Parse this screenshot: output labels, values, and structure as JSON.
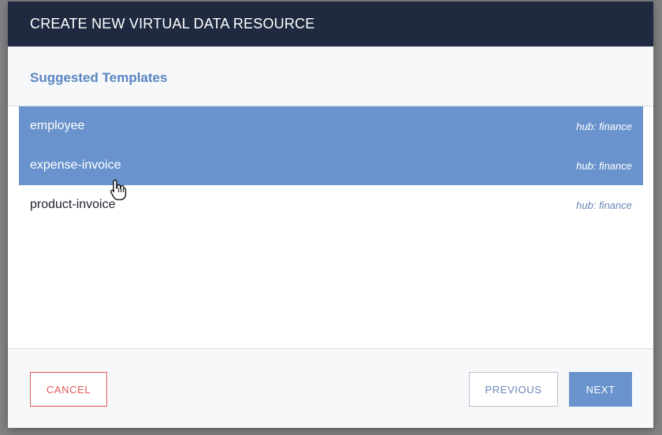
{
  "dialog": {
    "title": "CREATE NEW VIRTUAL DATA RESOURCE",
    "section_title": "Suggested Templates"
  },
  "templates": [
    {
      "name": "employee",
      "hub": "hub: finance",
      "selected": true
    },
    {
      "name": "expense-invoice",
      "hub": "hub: finance",
      "selected": true
    },
    {
      "name": "product-invoice",
      "hub": "hub: finance",
      "selected": false
    }
  ],
  "buttons": {
    "cancel": "CANCEL",
    "previous": "PREVIOUS",
    "next": "NEXT"
  },
  "colors": {
    "header_bg": "#1f2a40",
    "accent": "#6a93cd",
    "section_title": "#5b85c2",
    "cancel": "#e0585a"
  },
  "icons": {
    "cursor": "hand-pointer-icon"
  }
}
